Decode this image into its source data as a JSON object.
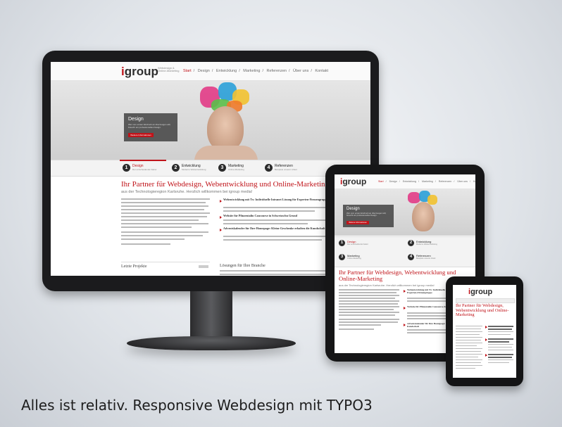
{
  "caption": "Alles ist relativ. Responsive Webdesign mit TYPO3",
  "brand": {
    "logo_i": "i",
    "logo_rest": "group",
    "logo_sub_1": "Webdesign &",
    "logo_sub_2": "Online-Marketing",
    "accent": "#c0141a"
  },
  "nav": {
    "items": [
      "Start",
      "Design",
      "Entwicklung",
      "Marketing",
      "Referenzen",
      "Über uns",
      "Kontakt"
    ],
    "separator": "/"
  },
  "hero": {
    "title": "Design",
    "text": "Wer vom ersten Eindruck an überzeugen will, braucht ein professionelles Design.",
    "button": "Weitere Informationen"
  },
  "steps": [
    {
      "num": "1",
      "label": "Design",
      "sub": "Der entscheidende Faktor"
    },
    {
      "num": "2",
      "label": "Entwicklung",
      "sub": "Moderne Webentwicklung"
    },
    {
      "num": "3",
      "label": "Marketing",
      "sub": "Online-Marketing"
    },
    {
      "num": "4",
      "label": "Referenzen",
      "sub": "Beispiele unserer Arbeit"
    }
  ],
  "main": {
    "headline": "Ihr Partner für Webdesign, Webentwicklung und Online-Marketing",
    "subline": "aus der Technologieregion Karlsruhe. Herzlich willkommen bei igroup media!",
    "news": [
      "Webentwicklung mit Tx: Individuelle Intranet Lösung für Experten-Firmengruppe",
      "Website für Pfinzentalin Cancourse in Schwetzschn Grund",
      "Adventskalender für Ihre Homepage: Kleine Geschenke erhalten die Kundschaft"
    ],
    "box_left": "Letzte Projekte",
    "box_right": "Lösungen für Ihre Branche"
  },
  "tablet": {
    "headline": "Ihr Partner für Webdesign, Webentwicklung und Online-Marketing",
    "subline": "aus der Technologieregion Karlsruhe. Herzlich willkommen bei igroup media!",
    "news": [
      "Webentwicklung mit Tx: Individuelle Intranet-Lösung für Experten-Firmengruppe",
      "Website für Pfinzentalin Cancourse & Sachbuch Center",
      "Adventskalender für Ihre Homepage: Geschenke erhalten die Kundschaft"
    ]
  },
  "phone": {
    "headline": "Ihr Partner für Webdesign, Webentwicklung und Online-Marketing"
  }
}
